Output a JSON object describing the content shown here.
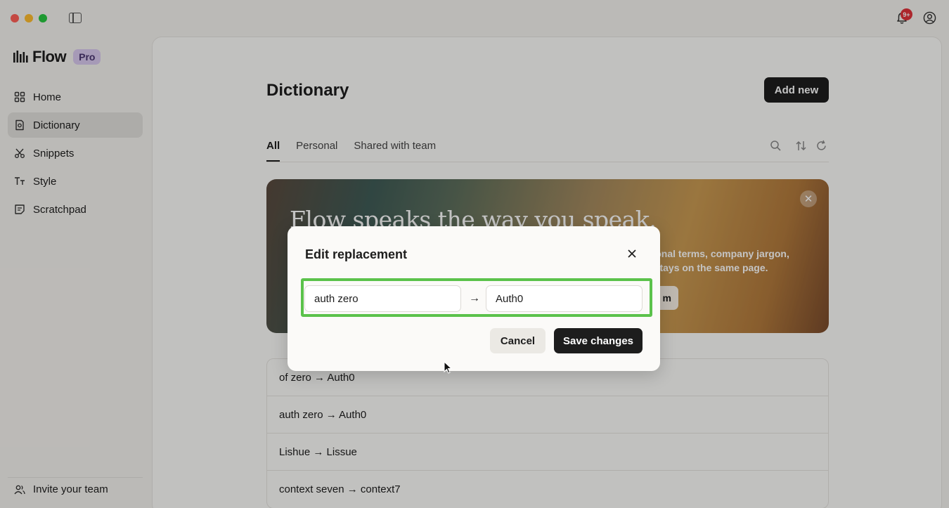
{
  "app": {
    "name": "Flow",
    "plan_badge": "Pro",
    "notification_badge": "9+"
  },
  "sidebar": {
    "items": [
      {
        "label": "Home",
        "icon": "grid-icon"
      },
      {
        "label": "Dictionary",
        "icon": "book-icon",
        "active": true
      },
      {
        "label": "Snippets",
        "icon": "scissors-icon"
      },
      {
        "label": "Style",
        "icon": "text-style-icon"
      },
      {
        "label": "Scratchpad",
        "icon": "note-icon"
      }
    ],
    "invite_label": "Invite your team"
  },
  "main": {
    "title": "Dictionary",
    "add_new_label": "Add new",
    "tabs": [
      {
        "label": "All",
        "active": true
      },
      {
        "label": "Personal"
      },
      {
        "label": "Shared with team"
      }
    ],
    "banner": {
      "title": "Flow speaks the way you speak.",
      "text_line1": "rsonal terms, company jargon,",
      "text_line2": "e stays on the same page.",
      "button_label": "m"
    },
    "entries": [
      "of zero → Auth0",
      "auth zero → Auth0",
      "Lishue → Lissue",
      "context seven → context7"
    ]
  },
  "modal": {
    "title": "Edit replacement",
    "from_value": "auth zero",
    "to_value": "Auth0",
    "arrow": "→",
    "cancel_label": "Cancel",
    "save_label": "Save changes"
  },
  "colors": {
    "accent_dark": "#1d1d1d",
    "pro_badge": "#d9c9ef",
    "highlight": "#5bc24b",
    "notification": "#e0323a"
  }
}
